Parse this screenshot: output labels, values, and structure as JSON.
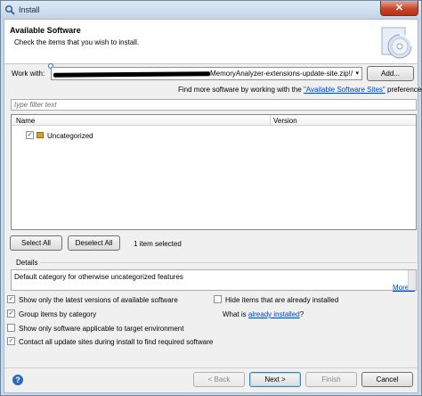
{
  "window": {
    "title": "Install",
    "close_glyph": "✕"
  },
  "banner": {
    "title": "Available Software",
    "subtitle": "Check the items that you wish to install."
  },
  "work_with": {
    "label": "Work with:",
    "value": "MemoryAnalyzer-extensions-update-site.zip!/",
    "add_label": "Add...",
    "find_more_prefix": "Find more software by working with the ",
    "find_more_link": "\"Available Software Sites\"",
    "find_more_suffix": " preferences."
  },
  "filter": {
    "placeholder": "type filter text"
  },
  "tree": {
    "columns": [
      "Name",
      "Version"
    ],
    "rows": [
      {
        "label": "Uncategorized",
        "checked": true,
        "version": ""
      }
    ]
  },
  "selection": {
    "select_all": "Select All",
    "deselect_all": "Deselect All",
    "count_text": "1 item selected"
  },
  "details": {
    "label": "Details",
    "text": "Default category for otherwise uncategorized features",
    "more_link": "More..."
  },
  "options": {
    "latest_versions": {
      "label": "Show only the latest versions of available software",
      "checked": true
    },
    "group_by_category": {
      "label": "Group items by category",
      "checked": true
    },
    "target_env": {
      "label": "Show only software applicable to target environment",
      "checked": false
    },
    "contact_sites": {
      "label": "Contact all update sites during install to find required software",
      "checked": true
    },
    "hide_installed": {
      "label": "Hide items that are already installed",
      "checked": false
    },
    "what_is_prefix": "What is ",
    "already_installed_link": "already installed",
    "what_is_suffix": "?"
  },
  "footer": {
    "back": "< Back",
    "next": "Next >",
    "finish": "Finish",
    "cancel": "Cancel"
  },
  "icons": {
    "check": "✓",
    "dropdown": "▾",
    "help": "?"
  }
}
